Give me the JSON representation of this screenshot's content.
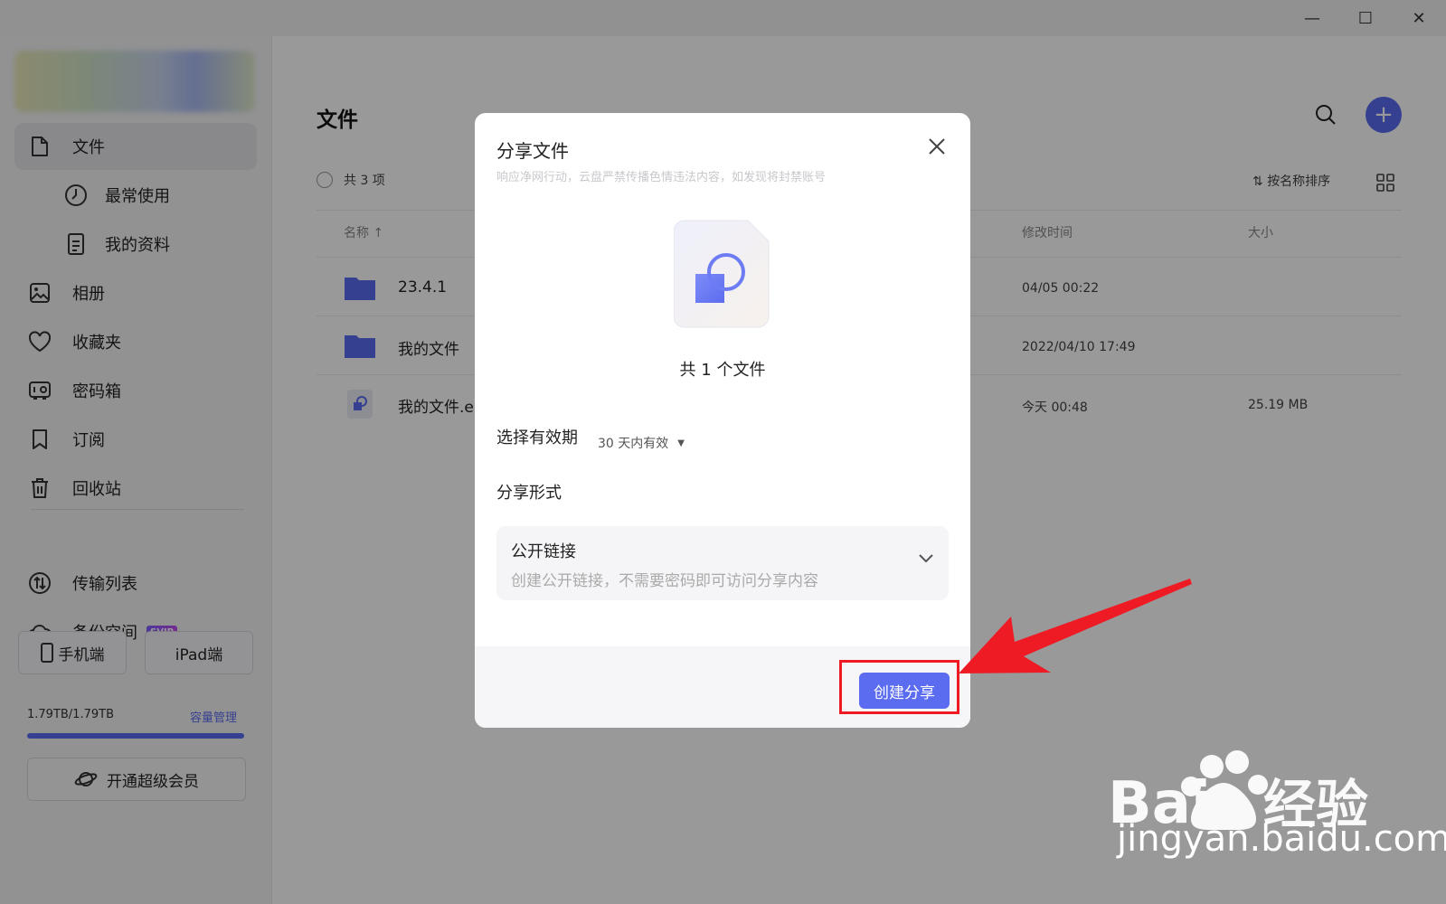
{
  "window": {
    "minimize_glyph": "—",
    "maximize_glyph": "☐",
    "close_glyph": "✕"
  },
  "sidebar": {
    "items": [
      {
        "label": "文件",
        "icon": "file-icon"
      },
      {
        "label": "最常使用",
        "icon": "clock-icon"
      },
      {
        "label": "我的资料",
        "icon": "document-icon"
      },
      {
        "label": "相册",
        "icon": "photo-icon"
      },
      {
        "label": "收藏夹",
        "icon": "heart-icon"
      },
      {
        "label": "密码箱",
        "icon": "safe-icon"
      },
      {
        "label": "订阅",
        "icon": "bookmark-icon"
      },
      {
        "label": "回收站",
        "icon": "trash-icon"
      }
    ],
    "transfer_label": "传输列表",
    "backup_label": "备份空间",
    "svip_badge": "SVIP",
    "phone_label": "手机端",
    "ipad_label": "iPad端",
    "quota_text": "1.79TB/1.79TB",
    "quota_link": "容量管理",
    "quota_used": 1.0,
    "vip_label": "开通超级会员"
  },
  "main": {
    "title": "文件",
    "count_label": "共 3 项",
    "sort_label": "按名称排序",
    "columns": {
      "name": "名称",
      "modified": "修改时间",
      "size": "大小"
    },
    "rows": [
      {
        "name": "23.4.1",
        "modified": "04/05 00:22",
        "size": ""
      },
      {
        "name": "我的文件",
        "modified": "2022/04/10 17:49",
        "size": ""
      },
      {
        "name": "我的文件.e",
        "modified": "今天 00:48",
        "size": "25.19 MB"
      }
    ]
  },
  "modal": {
    "title": "分享文件",
    "subtitle": "响应净网行动，云盘严禁传播色情违法内容，如发现将封禁账号",
    "file_count": "共 1 个文件",
    "expiry_label": "选择有效期",
    "expiry_value": "30 天内有效",
    "share_form_label": "分享形式",
    "share_type": "公开链接",
    "share_desc": "创建公开链接，不需要密码即可访问分享内容",
    "create_button": "创建分享"
  },
  "watermark": {
    "url_text": "jingyan.baidu.com"
  },
  "colors": {
    "accent": "#5b6cf0",
    "annotation": "#ee1b24"
  }
}
